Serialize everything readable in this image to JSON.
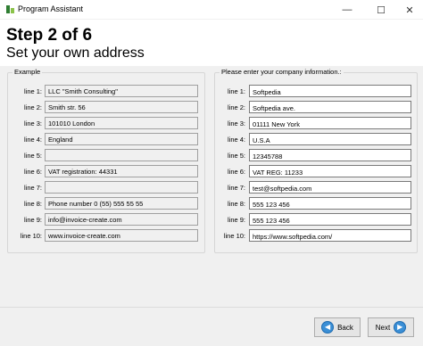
{
  "window": {
    "title": "Program Assistant",
    "minimize_glyph": "—",
    "maximize_glyph": "☐",
    "close_glyph": "✕"
  },
  "header": {
    "step": "Step 2 of 6",
    "subtitle": "Set your own address"
  },
  "example": {
    "legend": "Example",
    "rows": [
      {
        "label": "line 1:",
        "value": "LLC \"Smith Consulting\""
      },
      {
        "label": "line 2:",
        "value": "Smith str. 56"
      },
      {
        "label": "line 3:",
        "value": "101010 London"
      },
      {
        "label": "line 4:",
        "value": "England"
      },
      {
        "label": "line 5:",
        "value": ""
      },
      {
        "label": "line 6:",
        "value": "VAT registration: 44331"
      },
      {
        "label": "line 7:",
        "value": ""
      },
      {
        "label": "line 8:",
        "value": "Phone number 0 (55) 555 55 55"
      },
      {
        "label": "line 9:",
        "value": "info@invoice-create.com"
      },
      {
        "label": "line 10:",
        "value": "www.invoice-create.com"
      }
    ]
  },
  "company": {
    "legend": "Please enter your company information.:",
    "rows": [
      {
        "label": "line 1:",
        "value": "Softpedia"
      },
      {
        "label": "line 2:",
        "value": "Softpedia ave."
      },
      {
        "label": "line 3:",
        "value": "01111 New York"
      },
      {
        "label": "line 4:",
        "value": "U.S.A"
      },
      {
        "label": "line 5:",
        "value": "12345788"
      },
      {
        "label": "line 6:",
        "value": "VAT REG: 11233"
      },
      {
        "label": "line 7:",
        "value": "test@softpedia.com"
      },
      {
        "label": "line 8:",
        "value": "555 123 456"
      },
      {
        "label": "line 9:",
        "value": "555 123 456"
      },
      {
        "label": "line 10:",
        "value": "https://www.softpedia.com/"
      }
    ]
  },
  "footer": {
    "back_label": "Back",
    "next_label": "Next",
    "back_arrow": "◀",
    "next_arrow": "▶"
  },
  "colors": {
    "accent": "#3b8fd6",
    "panel": "#f0f0f0"
  },
  "icons": {
    "app": "program-assistant-app-icon",
    "back": "left-arrow-icon",
    "next": "right-arrow-icon"
  }
}
